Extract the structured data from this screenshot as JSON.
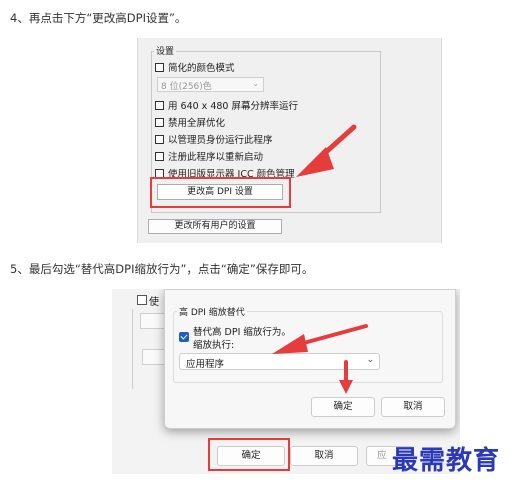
{
  "steps": {
    "step4": "4、再点击下方“更改高DPI设置”。",
    "step5": "5、最后勾选“替代高DPI缩放行为”，点击“确定”保存即可。"
  },
  "panel1": {
    "group_title": "设置",
    "reduced_color_label": "简化的颜色模式",
    "color_select_value": "8 位(256)色",
    "options": [
      "用 640 x 480 屏幕分辨率运行",
      "禁用全屏优化",
      "以管理员身份运行此程序",
      "注册此程序以重新启动",
      "使用旧版显示器 ICC 颜色管理"
    ],
    "dpi_button": "更改高 DPI 设置",
    "all_users_button": "更改所有用户的设置"
  },
  "panel2": {
    "override_group_title": "高 DPI 缩放替代",
    "override_checkbox_line1": "替代高 DPI 缩放行为。",
    "override_checkbox_line2": "缩放执行:",
    "scaling_select_value": "应用程序",
    "dialog_ok": "确定",
    "dialog_cancel": "取消",
    "main_ok": "确定",
    "main_cancel": "取消",
    "main_apply_partial": "应",
    "bg_checkbox_partial": "使"
  },
  "watermark": "最需教育",
  "colors": {
    "highlight_red": "#e53c3c",
    "checkbox_blue": "#1f5fbf",
    "watermark_blue": "#2b39b8"
  }
}
